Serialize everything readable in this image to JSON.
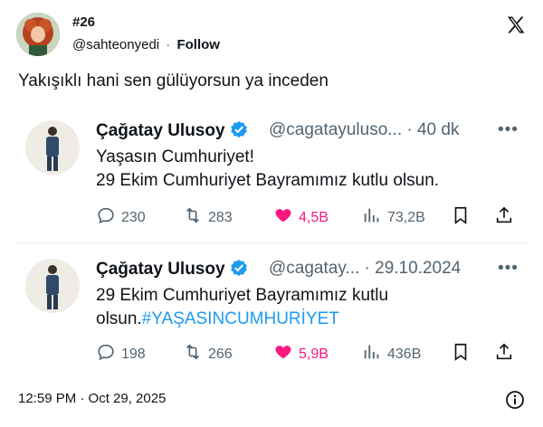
{
  "tweet": {
    "display_name": "#26",
    "handle": "@sahteonyedi",
    "separator": "·",
    "follow_label": "Follow",
    "text": "Yakışıklı hani sen gülüyorsun ya inceden",
    "timestamp": "12:59 PM · Oct 29, 2025"
  },
  "quotes": [
    {
      "name": "Çağatay Ulusoy",
      "meta": "@cagatayuluso... · 40 dk",
      "more": "•••",
      "lines": [
        "Yaşasın Cumhuriyet!",
        "29 Ekim Cumhuriyet Bayramımız kutlu olsun."
      ],
      "hashtag": "",
      "replies": "230",
      "retweets": "283",
      "likes": "4,5B",
      "views": "73,2B"
    },
    {
      "name": "Çağatay Ulusoy",
      "meta": "@cagatay... · 29.10.2024",
      "more": "•••",
      "lines": [
        "29 Ekim Cumhuriyet Bayramımız kutlu",
        "olsun."
      ],
      "hashtag": "#YAŞASINCUMHURİYET",
      "replies": "198",
      "retweets": "266",
      "likes": "5,9B",
      "views": "436B"
    }
  ],
  "colors": {
    "accent": "#1d9bf0",
    "like": "#f91880",
    "muted": "#536471",
    "verified": "#1d9bf0"
  },
  "icons": [
    "x-logo-icon",
    "verified-badge-icon",
    "more-icon",
    "reply-icon",
    "retweet-icon",
    "heart-icon",
    "views-icon",
    "bookmark-icon",
    "share-icon",
    "info-icon"
  ]
}
